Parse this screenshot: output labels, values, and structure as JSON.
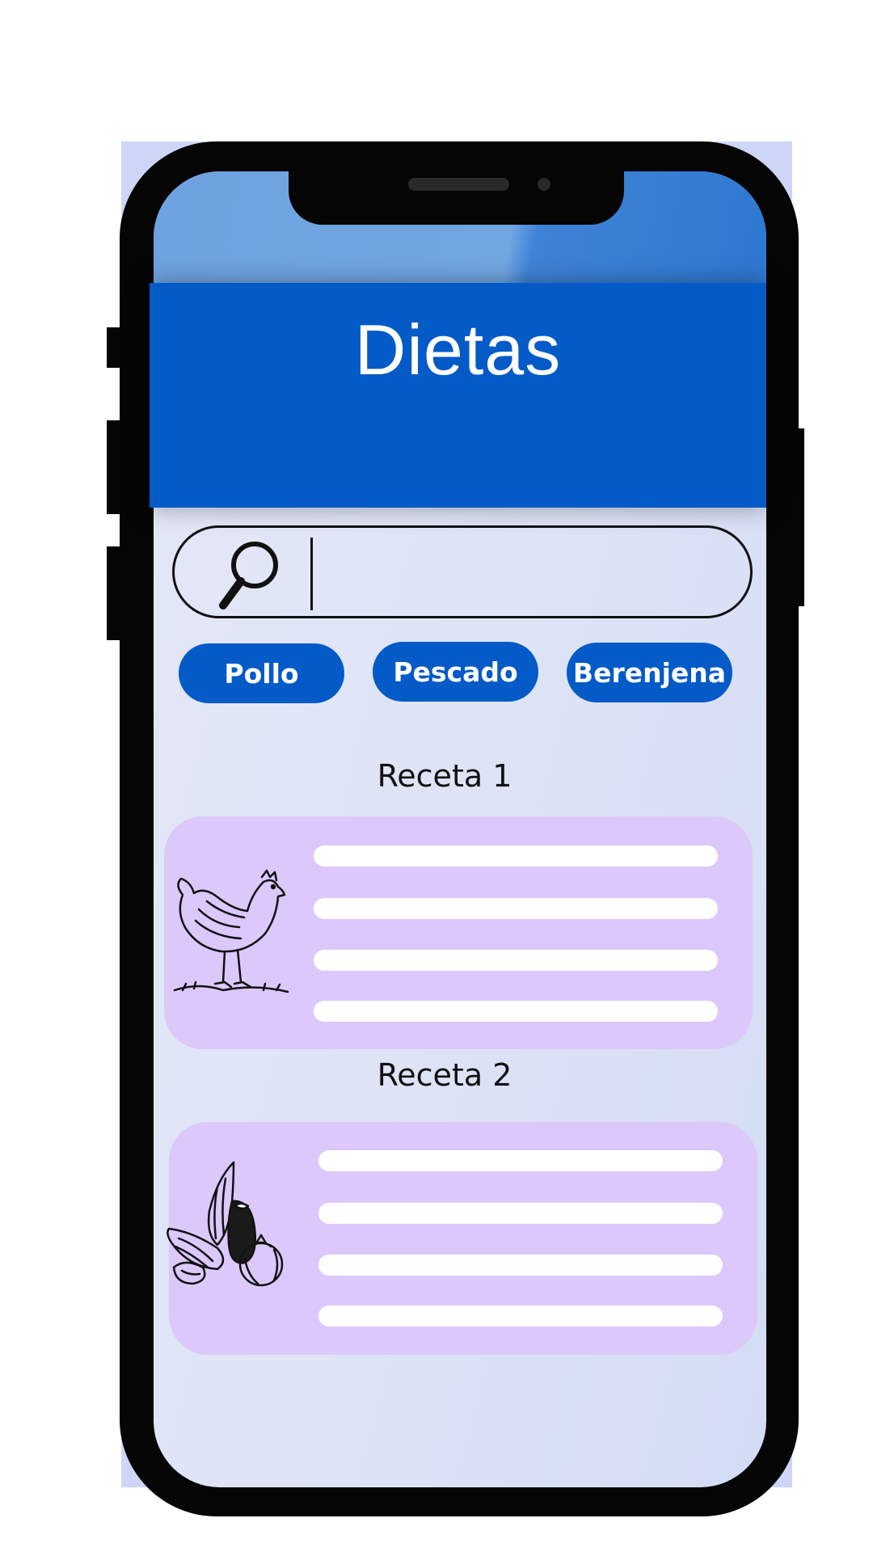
{
  "app": {
    "title": "Dietas"
  },
  "search": {
    "placeholder": "",
    "value": ""
  },
  "filters": [
    "Pollo",
    "Pescado",
    "Berenjena"
  ],
  "recipes": [
    {
      "title": "Receta 1",
      "image": "chicken-illustration"
    },
    {
      "title": "Receta 2",
      "image": "vegetables-illustration"
    }
  ],
  "colors": {
    "header": "#045ac7",
    "chip": "#045ac7",
    "card": "#dcc8fa",
    "screen": "#dde3f6"
  }
}
